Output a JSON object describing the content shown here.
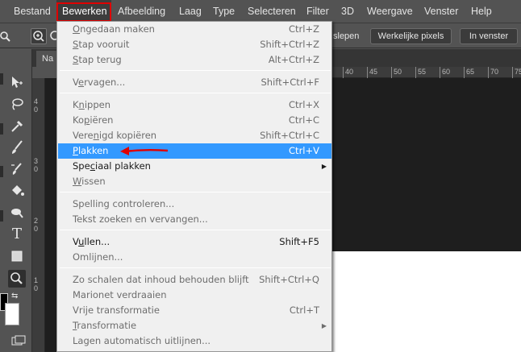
{
  "menubar": {
    "items": [
      "Bestand",
      "Bewerken",
      "Afbeelding",
      "Laag",
      "Type",
      "Selecteren",
      "Filter",
      "3D",
      "Weergave",
      "Venster",
      "Help"
    ]
  },
  "options": {
    "drag_partial": "slepen",
    "actual_pixels": "Werkelijke pixels",
    "fit_window": "In venster"
  },
  "document_tab": "Na",
  "ruler": {
    "top_ticks": [
      "40",
      "45",
      "50",
      "55",
      "60",
      "65",
      "70",
      "75"
    ],
    "left_ticks": [
      "4\n0",
      "4\n5",
      "3\n0",
      "3\n5",
      "2\n0",
      "2\n5",
      "1\n0",
      "1\n5"
    ]
  },
  "edit_menu": {
    "items": [
      {
        "label": "Ongedaan maken",
        "mn": "O",
        "shortcut": "Ctrl+Z",
        "enabled": false
      },
      {
        "label": "Stap vooruit",
        "mn": "S",
        "shortcut": "Shift+Ctrl+Z",
        "enabled": false
      },
      {
        "label": "Stap terug",
        "mn": "S",
        "shortcut": "Alt+Ctrl+Z",
        "enabled": false
      },
      {
        "label": "Vervagen...",
        "mn": "e",
        "shortcut": "Shift+Ctrl+F",
        "enabled": false
      },
      {
        "label": "Knippen",
        "mn": "n",
        "shortcut": "Ctrl+X",
        "enabled": false
      },
      {
        "label": "Kopiëren",
        "mn": "p",
        "shortcut": "Ctrl+C",
        "enabled": false
      },
      {
        "label": "Verenigd kopiëren",
        "mn": "n",
        "shortcut": "Shift+Ctrl+C",
        "enabled": false
      },
      {
        "label": "Plakken",
        "mn": "P",
        "shortcut": "Ctrl+V",
        "enabled": true,
        "highlighted": true
      },
      {
        "label": "Speciaal plakken",
        "mn": "c",
        "shortcut": "",
        "enabled": true,
        "submenu": true
      },
      {
        "label": "Wissen",
        "mn": "W",
        "shortcut": "",
        "enabled": false
      },
      {
        "label": "Spelling controleren...",
        "mn": "",
        "shortcut": "",
        "enabled": false
      },
      {
        "label": "Tekst zoeken en vervangen...",
        "mn": "",
        "shortcut": "",
        "enabled": false
      },
      {
        "label": "Vullen...",
        "mn": "u",
        "shortcut": "Shift+F5",
        "enabled": true
      },
      {
        "label": "Omlijnen...",
        "mn": "",
        "shortcut": "",
        "enabled": false
      },
      {
        "label": "Zo schalen dat inhoud behouden blijft",
        "mn": "",
        "shortcut": "Shift+Ctrl+Q",
        "enabled": false
      },
      {
        "label": "Marionet verdraaien",
        "mn": "",
        "shortcut": "",
        "enabled": false
      },
      {
        "label": "Vrije transformatie",
        "mn": "",
        "shortcut": "Ctrl+T",
        "enabled": false
      },
      {
        "label": "Transformatie",
        "mn": "T",
        "shortcut": "",
        "enabled": false,
        "submenu": true
      },
      {
        "label": "Lagen automatisch uitlijnen...",
        "mn": "",
        "shortcut": "",
        "enabled": false
      }
    ]
  },
  "colors": {
    "highlight": "#3399ff",
    "annotation": "#e00000"
  },
  "icons": [
    "magnifier-icon",
    "move-icon",
    "lasso-icon",
    "wand-icon",
    "eyedropper-icon",
    "brush-icon",
    "stamp-icon",
    "history-brush-icon",
    "paint-bucket-icon",
    "dodge-icon",
    "type-icon",
    "rectangle-icon",
    "zoom-icon",
    "swap-colors-icon",
    "screen-mode-icon",
    "submenu-arrow-icon"
  ]
}
